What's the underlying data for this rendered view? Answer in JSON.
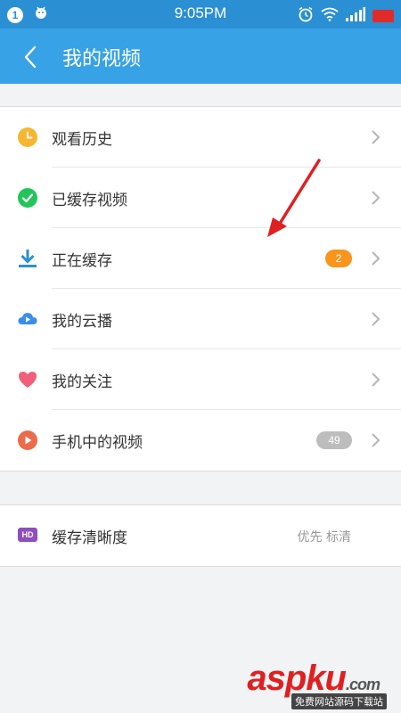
{
  "status_bar": {
    "notification_count": "1",
    "time": "9:05PM",
    "icons": [
      "android-icon",
      "alarm-icon",
      "wifi-icon",
      "signal-icon",
      "battery-icon"
    ]
  },
  "app_bar": {
    "title": "我的视频",
    "back_icon": "back-arrow-icon",
    "background": "#37a2e6"
  },
  "menu": {
    "items": [
      {
        "label": "观看历史",
        "icon": "clock-icon",
        "icon_color": "#f7b632"
      },
      {
        "label": "已缓存视频",
        "icon": "check-circle-icon",
        "icon_color": "#22c55a"
      },
      {
        "label": "正在缓存",
        "icon": "download-icon",
        "icon_color": "#2a8fd3",
        "badge": "2",
        "badge_color": "#f7951d"
      },
      {
        "label": "我的云播",
        "icon": "cloud-play-icon",
        "icon_color": "#3a8ee6"
      },
      {
        "label": "我的关注",
        "icon": "heart-icon",
        "icon_color": "#f0607a"
      },
      {
        "label": "手机中的视频",
        "icon": "play-circle-icon",
        "icon_color": "#ec6b4a",
        "badge": "49",
        "badge_color": "#bdbdbd"
      }
    ]
  },
  "settings": {
    "cache_quality": {
      "label": "缓存清晰度",
      "icon": "hd-icon",
      "icon_text": "HD",
      "value": "优先 标清"
    }
  },
  "watermark": {
    "brand_asp": "asp",
    "brand_ku": "ku",
    "brand_suffix": ".com",
    "subtitle": "免费网站源码下载站"
  }
}
